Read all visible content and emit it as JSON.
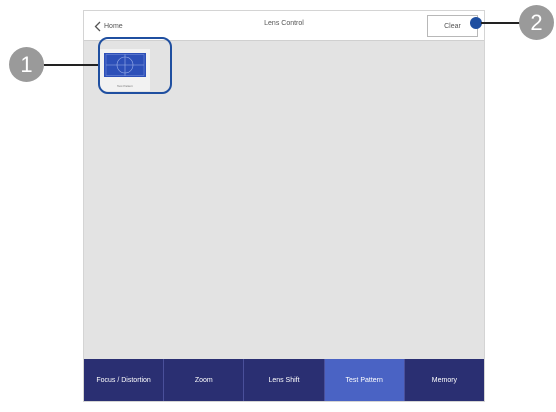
{
  "topbar": {
    "back_label": "Home",
    "title": "Lens Control",
    "clear_label": "Clear"
  },
  "pattern": {
    "label": "Test Pattern",
    "thumb_color": "#2c4fb8"
  },
  "tabs": [
    {
      "label": "Focus / Distortion",
      "active": false
    },
    {
      "label": "Zoom",
      "active": false
    },
    {
      "label": "Lens Shift",
      "active": false
    },
    {
      "label": "Test Pattern",
      "active": true
    },
    {
      "label": "Memory",
      "active": false
    }
  ],
  "callouts": [
    {
      "number": "1"
    },
    {
      "number": "2"
    }
  ],
  "colors": {
    "tab_bar": "#2a2f72",
    "tab_active": "#4a63c4",
    "callout_accent": "#1f4fa0"
  }
}
